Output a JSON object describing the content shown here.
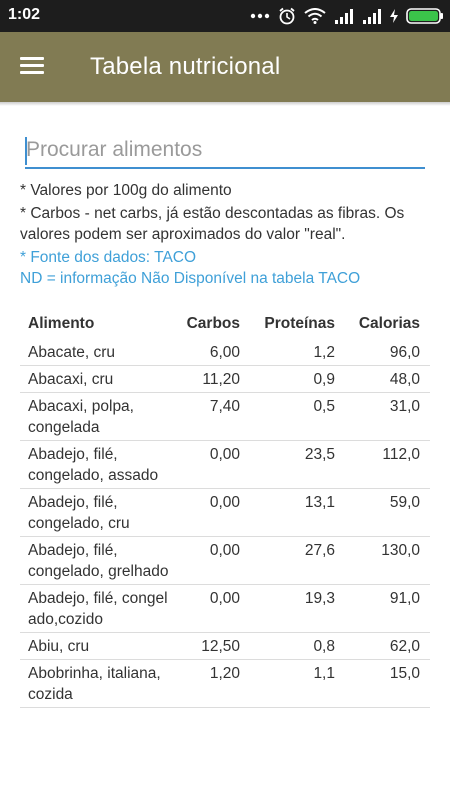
{
  "status": {
    "time": "1:02"
  },
  "appbar": {
    "title": "Tabela nutricional",
    "menu_icon": "hamburger-menu-icon"
  },
  "search": {
    "placeholder": "Procurar alimentos"
  },
  "notes": {
    "line1": "* Valores por 100g do alimento",
    "line2": "* Carbos  - net carbs, já estão descontadas as fibras. Os valores podem ser aproximados do valor \"real\".",
    "source": "* Fonte dos dados: TACO",
    "nd": "ND = informação Não Disponível na tabela TACO"
  },
  "table": {
    "headers": {
      "name": "Alimento",
      "carbs": "Carbos",
      "protein": "Proteínas",
      "calories": "Calorias"
    },
    "rows": [
      {
        "name": "Abacate, cru",
        "carbs": "6,00",
        "protein": "1,2",
        "calories": "96,0"
      },
      {
        "name": "Abacaxi, cru",
        "carbs": "11,20",
        "protein": "0,9",
        "calories": "48,0"
      },
      {
        "name": "Abacaxi, polpa, congelada",
        "carbs": "7,40",
        "protein": "0,5",
        "calories": "31,0"
      },
      {
        "name": "Abadejo, filé, congelado, assado",
        "carbs": "0,00",
        "protein": "23,5",
        "calories": "112,0"
      },
      {
        "name": "Abadejo, filé, congelado, cru",
        "carbs": "0,00",
        "protein": "13,1",
        "calories": "59,0"
      },
      {
        "name": "Abadejo, filé, congelado, grelhado",
        "carbs": "0,00",
        "protein": "27,6",
        "calories": "130,0"
      },
      {
        "name": "Abadejo, filé, congelado,cozido",
        "carbs": "0,00",
        "protein": "19,3",
        "calories": "91,0"
      },
      {
        "name": "Abiu, cru",
        "carbs": "12,50",
        "protein": "0,8",
        "calories": "62,0"
      },
      {
        "name": "Abobrinha, italiana, cozida",
        "carbs": "1,20",
        "protein": "1,1",
        "calories": "15,0"
      }
    ]
  }
}
